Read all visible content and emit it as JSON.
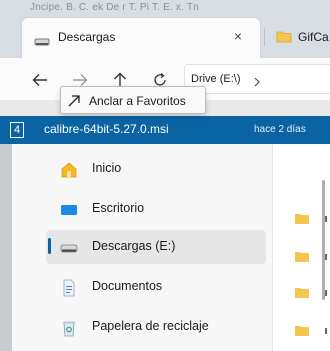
{
  "background_text": "Jncipe. B. C. ek De r T. Pi T. E. x. Tn",
  "tabs": [
    {
      "label": "Descargas",
      "icon": "drive-icon",
      "active": true
    },
    {
      "label": "GifCa",
      "icon": "folder-icon",
      "active": false
    }
  ],
  "tab_close_glyph": "×",
  "nav": {
    "back_glyph": "←",
    "forward_glyph": "→",
    "up_glyph": "↑",
    "refresh_glyph": "↻",
    "address_crumb": "Drive (E:\\)",
    "address_chevron": "›"
  },
  "tooltip": {
    "label": "Anclar a Favoritos",
    "icon": "arrow-up-right-icon"
  },
  "drag_banner": {
    "count": "4",
    "filename": "calibre-64bit-5.27.0.msi",
    "date": "hace 2 días",
    "color": "#0a63a3"
  },
  "sidebar": {
    "items": [
      {
        "label": "Inicio",
        "icon": "home-icon",
        "selected": false
      },
      {
        "label": "Escritorio",
        "icon": "desktop-icon",
        "selected": false
      },
      {
        "label": "Descargas (E:)",
        "icon": "drive-icon",
        "selected": true
      },
      {
        "label": "Documentos",
        "icon": "documents-icon",
        "selected": false
      },
      {
        "label": "Papelera de reciclaje",
        "icon": "recycle-bin-icon",
        "selected": false
      }
    ]
  },
  "colors": {
    "accent": "#0a63a3",
    "folder": "#f4c64f"
  }
}
